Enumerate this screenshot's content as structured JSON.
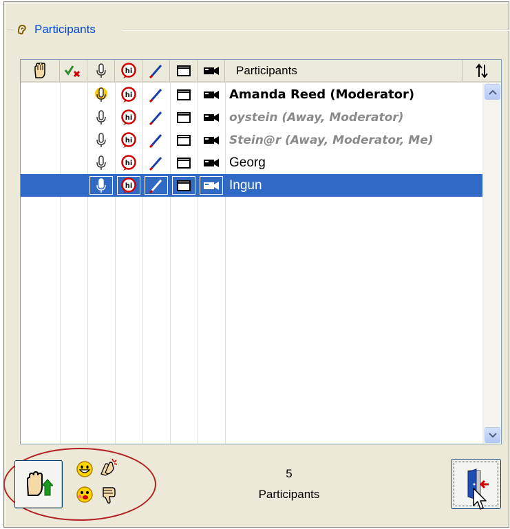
{
  "group": {
    "title": "Participants",
    "icon": "ear-icon"
  },
  "list": {
    "columns": [
      {
        "name": "raise-hand-col",
        "icon": "raised-hand-icon"
      },
      {
        "name": "check-col",
        "icon": "check-x-icon"
      },
      {
        "name": "mic-col",
        "icon": "microphone-icon"
      },
      {
        "name": "chat-col",
        "icon": "chat-bubble-icon"
      },
      {
        "name": "draw-col",
        "icon": "pen-icon"
      },
      {
        "name": "screen-col",
        "icon": "screen-icon"
      },
      {
        "name": "video-col",
        "icon": "camera-icon"
      },
      {
        "name": "name-col",
        "label": "Participants"
      }
    ],
    "sort_icon": "sort-arrows-icon",
    "rows": [
      {
        "name": "Amanda Reed (Moderator)",
        "style": "bold",
        "mic_active": true,
        "selected": false
      },
      {
        "name": "oystein (Away, Moderator)",
        "style": "away",
        "mic_active": false,
        "selected": false
      },
      {
        "name": "Stein@r (Away, Moderator, Me)",
        "style": "away",
        "mic_active": false,
        "selected": false
      },
      {
        "name": "Georg",
        "style": "normal",
        "mic_active": false,
        "selected": false
      },
      {
        "name": "Ingun",
        "style": "normal",
        "mic_active": false,
        "selected": true
      }
    ]
  },
  "footer": {
    "count_value": "5",
    "count_label": "Participants",
    "raise_hand_button": "raise-hand-icon",
    "emotes": [
      "smile-icon",
      "applause-icon",
      "confused-icon",
      "thumbs-down-icon"
    ],
    "exit_button": "exit-door-icon"
  },
  "colors": {
    "selection": "#316ac5",
    "group_title": "#0046d5",
    "highlight": "#b22222"
  }
}
